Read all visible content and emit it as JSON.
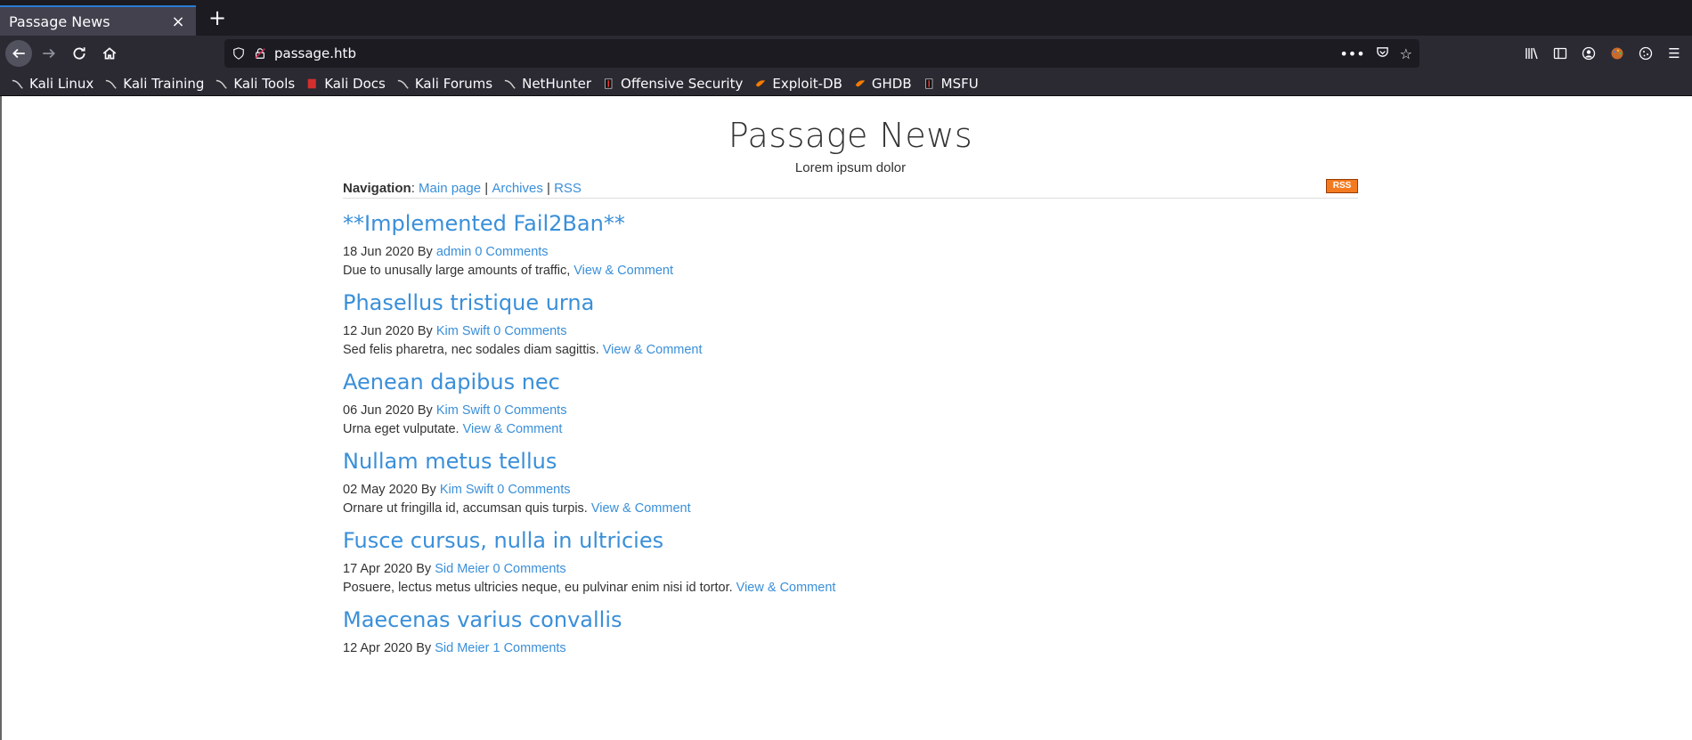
{
  "browser": {
    "tab_title": "Passage News",
    "url": "passage.htb",
    "bookmarks": [
      "Kali Linux",
      "Kali Training",
      "Kali Tools",
      "Kali Docs",
      "Kali Forums",
      "NetHunter",
      "Offensive Security",
      "Exploit-DB",
      "GHDB",
      "MSFU"
    ]
  },
  "site": {
    "title": "Passage News",
    "subtitle": "Lorem ipsum dolor",
    "nav_label": "Navigation",
    "nav_links": [
      "Main page",
      "Archives",
      "RSS"
    ],
    "rss_badge": "RSS"
  },
  "posts": [
    {
      "title": "**Implemented Fail2Ban**",
      "date": "18 Jun 2020",
      "by": "By",
      "author": "admin",
      "comments": "0 Comments",
      "excerpt": "Due to unusally large amounts of traffic,",
      "link": "View & Comment"
    },
    {
      "title": "Phasellus tristique urna",
      "date": "12 Jun 2020",
      "by": "By",
      "author": "Kim Swift",
      "comments": "0 Comments",
      "excerpt": "Sed felis pharetra, nec sodales diam sagittis.",
      "link": "View & Comment"
    },
    {
      "title": "Aenean dapibus nec",
      "date": "06 Jun 2020",
      "by": "By",
      "author": "Kim Swift",
      "comments": "0 Comments",
      "excerpt": "Urna eget vulputate.",
      "link": "View & Comment"
    },
    {
      "title": "Nullam metus tellus",
      "date": "02 May 2020",
      "by": "By",
      "author": "Kim Swift",
      "comments": "0 Comments",
      "excerpt": "Ornare ut fringilla id, accumsan quis turpis.",
      "link": "View & Comment"
    },
    {
      "title": "Fusce cursus, nulla in ultricies",
      "date": "17 Apr 2020",
      "by": "By",
      "author": "Sid Meier",
      "comments": "0 Comments",
      "excerpt": "Posuere, lectus metus ultricies neque, eu pulvinar enim nisi id tortor.",
      "link": "View & Comment"
    },
    {
      "title": "Maecenas varius convallis",
      "date": "12 Apr 2020",
      "by": "By",
      "author": "Sid Meier",
      "comments": "1 Comments",
      "excerpt": "",
      "link": ""
    }
  ]
}
